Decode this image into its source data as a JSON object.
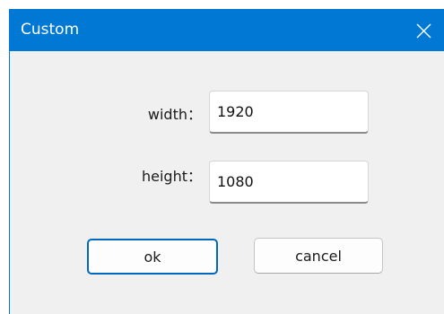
{
  "window": {
    "title": "Custom",
    "close_icon": "close-icon"
  },
  "form": {
    "width_label": "width：",
    "width_value": "1920",
    "height_label": "height：",
    "height_value": "1080"
  },
  "buttons": {
    "ok_label": "ok",
    "cancel_label": "cancel"
  },
  "colors": {
    "titlebar": "#0078d4",
    "dialog_bg": "#f0f0f0",
    "ok_border": "#0067c0"
  }
}
